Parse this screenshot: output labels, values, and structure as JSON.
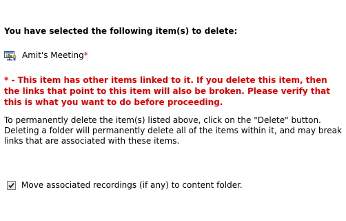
{
  "heading": "You have selected the following item(s) to delete:",
  "item": {
    "icon": "meeting-icon",
    "name": "Amit's Meeting",
    "marker": "*"
  },
  "warning": "* - This item has other items linked to it. If you delete this item, then the links that point to this item will also be broken. Please verify that this is what you want to do before proceeding.",
  "info": "To permanently delete the item(s) listed above, click on the \"Delete\" button. Deleting a folder will permanently delete all of the items within it, and may break links that are associated with these items.",
  "option": {
    "checked": true,
    "label": "Move associated recordings (if any) to content folder."
  },
  "colors": {
    "warning": "#e00000",
    "text": "#000000"
  }
}
